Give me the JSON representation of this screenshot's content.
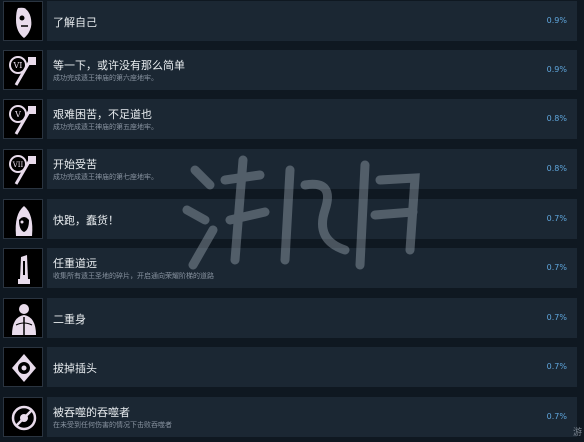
{
  "achievements": [
    {
      "title": "了解自己",
      "desc": "",
      "pct": "0.9%",
      "icon": "mask-face-icon"
    },
    {
      "title": "等一下，或许没有那么简单",
      "desc": "成功完成遗王神庙的第六座地牢。",
      "pct": "0.9%",
      "icon": "roman-six-key-icon"
    },
    {
      "title": "艰难困苦，不足道也",
      "desc": "成功完成遗王神庙的第五座地牢。",
      "pct": "0.8%",
      "icon": "roman-five-key-icon"
    },
    {
      "title": "开始受苦",
      "desc": "成功完成遗王神庙的第七座地牢。",
      "pct": "0.8%",
      "icon": "roman-seven-key-icon"
    },
    {
      "title": "快跑，蠢货！",
      "desc": "",
      "pct": "0.7%",
      "icon": "hooded-mask-icon"
    },
    {
      "title": "任重道远",
      "desc": "收集所有遗王圣地的碎片，开启通向荣耀阶梯的道路",
      "pct": "0.7%",
      "icon": "relic-shard-icon"
    },
    {
      "title": "二重身",
      "desc": "",
      "pct": "0.7%",
      "icon": "twin-body-icon"
    },
    {
      "title": "拔掉插头",
      "desc": "",
      "pct": "0.7%",
      "icon": "plug-trophy-icon"
    },
    {
      "title": "被吞噬的吞噬者",
      "desc": "在未受到任何伤害的情况下击败吞噬者",
      "pct": "0.7%",
      "icon": "devourer-icon"
    }
  ],
  "corner_text": "游"
}
